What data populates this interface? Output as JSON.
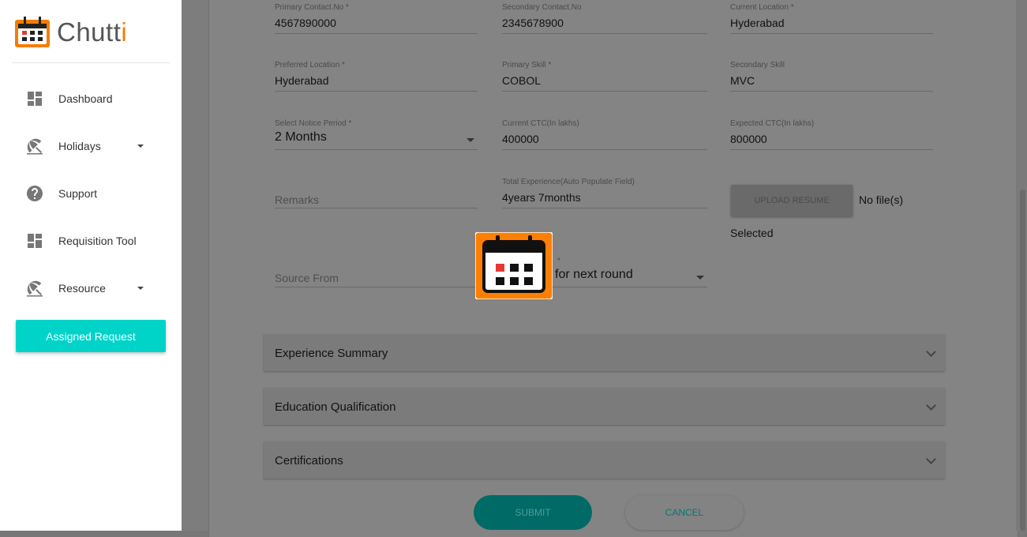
{
  "app": {
    "logo_text_main": "Chutt",
    "logo_text_accent": "i",
    "logo_icon": "calendar-icon"
  },
  "sidebar": {
    "items": [
      {
        "label": "Dashboard",
        "icon": "dashboard-icon"
      },
      {
        "label": "Holidays",
        "icon": "beach-icon",
        "has_dropdown": true
      },
      {
        "label": "Support",
        "icon": "help-icon"
      },
      {
        "label": "Requisition Tool",
        "icon": "dashboard-icon"
      },
      {
        "label": "Resource",
        "icon": "beach-icon",
        "has_dropdown": true
      }
    ],
    "active_button": "Assigned Request",
    "active_color": "#00d4c8"
  },
  "form": {
    "primary_contact": {
      "label": "Primary Contact.No *",
      "value": "4567890000"
    },
    "secondary_contact": {
      "label": "Secondary Contact.No",
      "value": "2345678900"
    },
    "current_location": {
      "label": "Current Location *",
      "value": "Hyderabad"
    },
    "preferred_location": {
      "label": "Preferred Location *",
      "value": "Hyderabad"
    },
    "primary_skill": {
      "label": "Primary Skill *",
      "value": "COBOL"
    },
    "secondary_skill": {
      "label": "Secondary Skill",
      "value": "MVC"
    },
    "notice_period": {
      "label": "Select Notice Period *",
      "value": "2 Months"
    },
    "current_ctc": {
      "label": "Current CTC(In lakhs)",
      "value": "400000"
    },
    "expected_ctc": {
      "label": "Expected CTC(In lakhs)",
      "value": "800000"
    },
    "remarks": {
      "placeholder": "Remarks"
    },
    "total_experience": {
      "label": "Total Experience(Auto Populate Field)",
      "value": "4years 7months"
    },
    "upload_resume": {
      "label": "UPLOAD RESUME",
      "no_file": "No file(s)",
      "selected": "Selected"
    },
    "source_from": {
      "placeholder": "Source From"
    },
    "status_select": {
      "label": "*",
      "value": "for next round"
    }
  },
  "panels": [
    {
      "title": "Experience Summary"
    },
    {
      "title": "Education Qualification"
    },
    {
      "title": "Certifications"
    }
  ],
  "actions": {
    "submit": "SUBMIT",
    "cancel": "CANCEL"
  },
  "colors": {
    "brand_orange": "#f57c00",
    "teal": "#00d4c8",
    "overlay": "#7d7d7d"
  }
}
